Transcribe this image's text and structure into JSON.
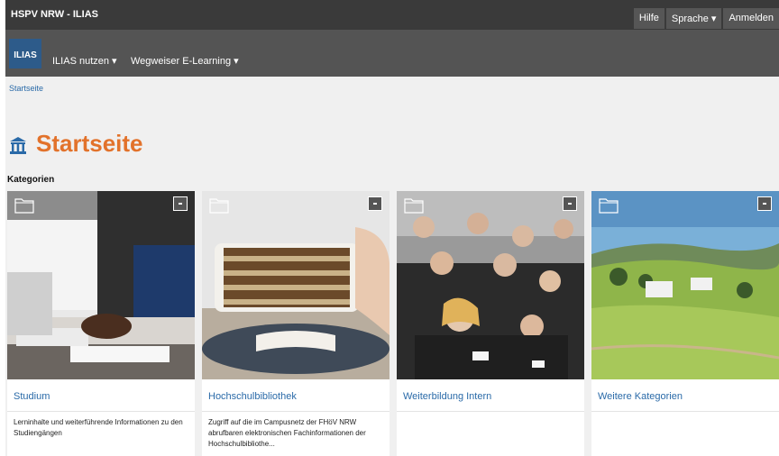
{
  "topbar": {
    "brand": "HSPV NRW - ILIAS",
    "help": "Hilfe",
    "language": "Sprache ▾",
    "login": "Anmelden"
  },
  "mainnav": {
    "logo_text": "ILIAS",
    "items": [
      {
        "label": "ILIAS nutzen ▾"
      },
      {
        "label": "Wegweiser E-Learning ▾"
      }
    ]
  },
  "breadcrumb": {
    "label": "Startseite"
  },
  "page": {
    "title": "Startseite",
    "section_label": "Kategorien",
    "accent": "#e2722b",
    "link_color": "#2a6aa8"
  },
  "cards": [
    {
      "title": "Studium",
      "description": "Lerninhalte und weiterführende Informationen zu den Studiengängen",
      "icon": "folder-icon"
    },
    {
      "title": "Hochschulbibliothek",
      "description": "Zugriff auf die im Campusnetz der FHöV NRW abrufbaren elektronischen Fachinformationen der Hochschulbibliothe...",
      "icon": "folder-icon"
    },
    {
      "title": "Weiterbildung Intern",
      "description": "",
      "icon": "folder-icon"
    },
    {
      "title": "Weitere Kategorien",
      "description": "",
      "icon": "folder-icon"
    }
  ]
}
